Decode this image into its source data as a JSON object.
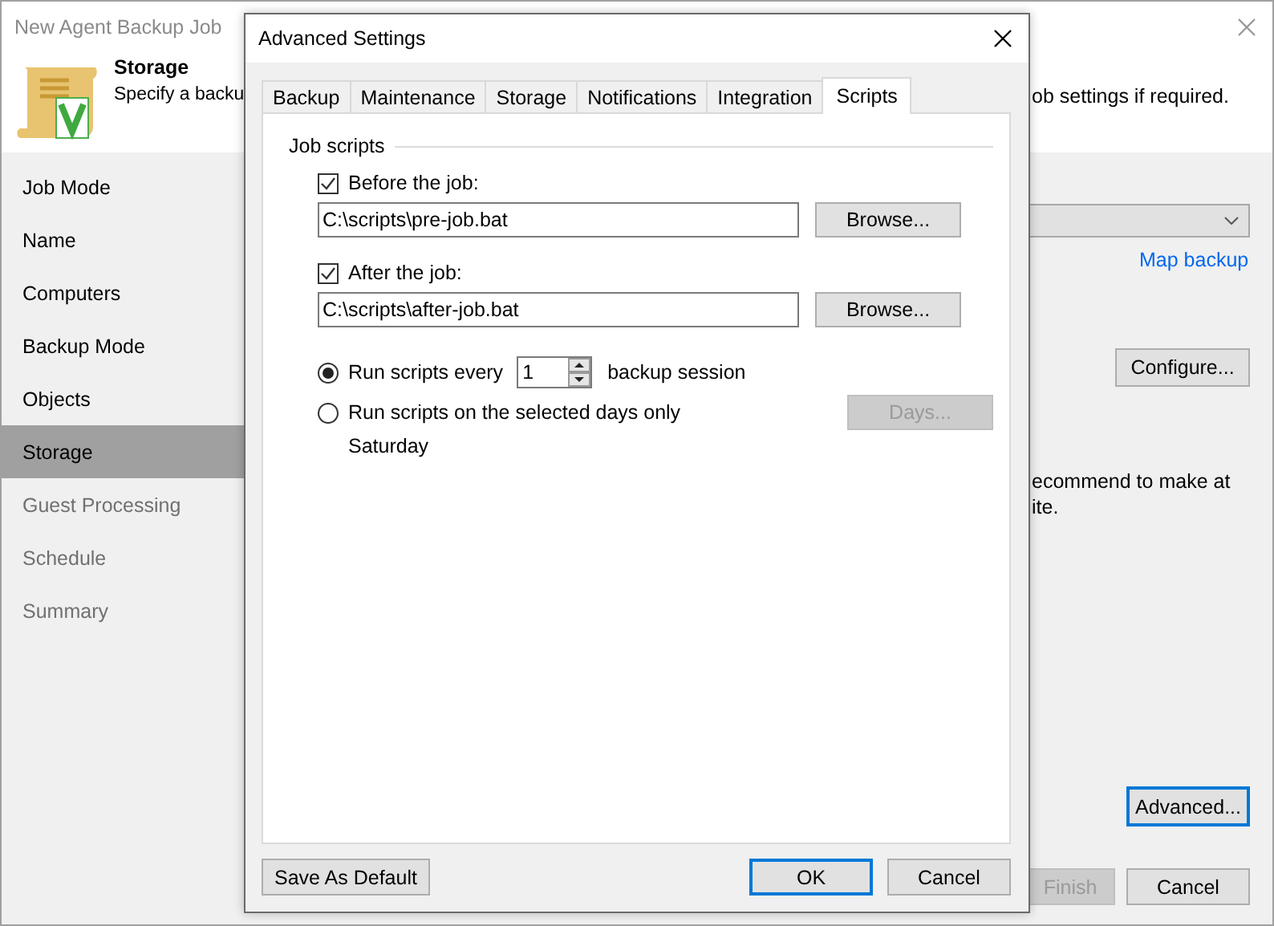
{
  "wizard": {
    "title": "New Agent Backup Job",
    "header": {
      "title": "Storage",
      "description": "Specify a backu",
      "description_tail": "ob settings if required."
    },
    "steps": [
      {
        "label": "Job Mode",
        "selected": false,
        "disabled": false
      },
      {
        "label": "Name",
        "selected": false,
        "disabled": false
      },
      {
        "label": "Computers",
        "selected": false,
        "disabled": false
      },
      {
        "label": "Backup Mode",
        "selected": false,
        "disabled": false
      },
      {
        "label": "Objects",
        "selected": false,
        "disabled": false
      },
      {
        "label": "Storage",
        "selected": true,
        "disabled": false
      },
      {
        "label": "Guest Processing",
        "selected": false,
        "disabled": true
      },
      {
        "label": "Schedule",
        "selected": false,
        "disabled": true
      },
      {
        "label": "Summary",
        "selected": false,
        "disabled": true
      }
    ],
    "content": {
      "map_link": "Map backup",
      "configure_button": "Configure...",
      "note_lines": [
        "ecommend to make at",
        "ite."
      ],
      "advanced_button": "Advanced..."
    },
    "buttons": [
      {
        "label": "Finish",
        "disabled": true
      },
      {
        "label": "Cancel",
        "disabled": false
      }
    ]
  },
  "dialog": {
    "title": "Advanced Settings",
    "tabs": [
      {
        "label": "Backup",
        "selected": false
      },
      {
        "label": "Maintenance",
        "selected": false
      },
      {
        "label": "Storage",
        "selected": false
      },
      {
        "label": "Notifications",
        "selected": false
      },
      {
        "label": "Integration",
        "selected": false
      },
      {
        "label": "Scripts",
        "selected": true
      }
    ],
    "group_title": "Job scripts",
    "scripts": [
      {
        "label": "Before the job:",
        "checked": true,
        "value": "C:\\scripts\\pre-job.bat",
        "browse": "Browse..."
      },
      {
        "label": "After the job:",
        "checked": true,
        "value": "C:\\scripts\\after-job.bat",
        "browse": "Browse..."
      }
    ],
    "options": [
      {
        "kind": "every",
        "label": "Run scripts every",
        "selected": true,
        "value": "1",
        "suffix": "backup session"
      },
      {
        "kind": "days",
        "label": "Run scripts on the selected days only",
        "selected": false,
        "button": "Days...",
        "button_disabled": true,
        "detail": "Saturday"
      }
    ],
    "buttons": [
      {
        "label": "Save As Default",
        "focused": false
      },
      {
        "label": "OK",
        "focused": true
      },
      {
        "label": "Cancel",
        "focused": false
      }
    ]
  }
}
